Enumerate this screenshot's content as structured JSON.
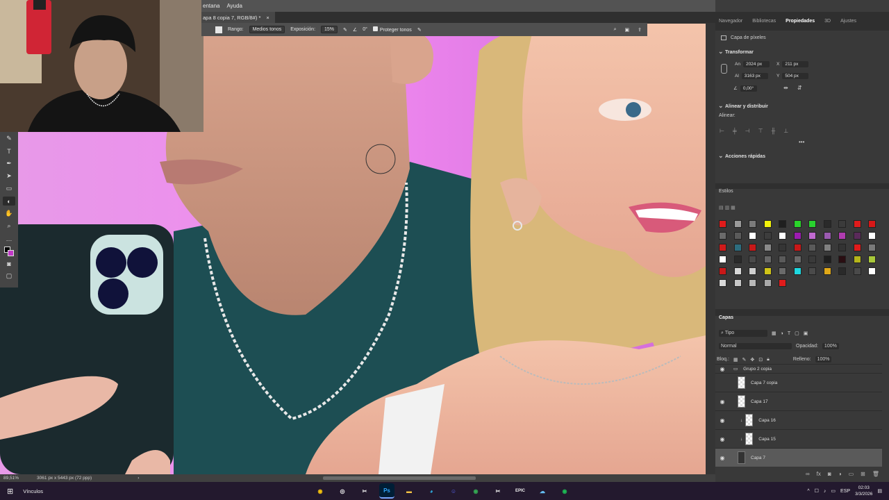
{
  "menubar": {
    "items": [
      "entana",
      "Ayuda"
    ]
  },
  "document_tab": {
    "title": "apa 8 copia 7, RGB/8#) *",
    "close": "×"
  },
  "options_bar": {
    "range_label": "Rango:",
    "range_value": "Medios tonos",
    "exposure_label": "Exposición:",
    "exposure_value": "15%",
    "angle_value": "0°",
    "protect_tones_label": "Proteger tonos"
  },
  "status_bar": {
    "zoom": "89,51%",
    "doc_info": "3061 px x 5443 px (72 ppp)"
  },
  "panel_tabs": [
    "Navegador",
    "Bibliotecas",
    "Propiedades",
    "3D",
    "Ajustes"
  ],
  "properties": {
    "layer_type": "Capa de píxeles",
    "transform_header": "Transformar",
    "width_label": "An",
    "width_value": "2024 px",
    "x_label": "X",
    "x_value": "211 px",
    "height_label": "Al",
    "height_value": "3163 px",
    "y_label": "Y",
    "y_value": "504 px",
    "angle_value": "0,00°",
    "align_header": "Alinear y distribuir",
    "align_label": "Alinear:",
    "quick_actions_header": "Acciones rápidas"
  },
  "styles_panel": {
    "title": "Estilos",
    "swatches": [
      "#e01b1b",
      "#9a9a9a",
      "#7b7b7b",
      "#f2f20b",
      "#1f1f1f",
      "#2ad42a",
      "#29d12f",
      "#2a2a2a",
      "#3b3b3b",
      "#e01b1b",
      "#d81818",
      "#6b6b6b",
      "#5a5a5a",
      "#ffffff",
      "#3d3d3d",
      "#ffffff",
      "#9b1bb0",
      "#c06ad0",
      "#9a5ab0",
      "#b03cb0",
      "#5a2a5a",
      "#ffffff",
      "#cf1a1a",
      "#2d6d7f",
      "#c81818",
      "#8a8a8a",
      "#353535",
      "#c81818",
      "#5a5a5a",
      "#808080",
      "#333333",
      "#e01b1b",
      "#7a7a7a",
      "#ffffff",
      "#2a2a2a",
      "#4a4a4a",
      "#686868",
      "#5a5a5a",
      "#6a6a6a",
      "#3a3a3a",
      "#1e1e1e",
      "#2a0e12",
      "#b5b51a",
      "#a8c83a",
      "#c81818",
      "#d8d8d8",
      "#cfcfcf",
      "#d0c418",
      "#6a6a6a",
      "#1ed8e0",
      "#4a4a4a",
      "#e0a818",
      "#2a2a2a",
      "#4a4a4a",
      "#ffffff",
      "#dadada",
      "#c8c8c8",
      "#b8b8b8",
      "#a8a8a8",
      "#e01b1b"
    ]
  },
  "layers_panel": {
    "title": "Capas",
    "filter_value": "Tipo",
    "blend_mode": "Normal",
    "opacity_label": "Opacidad:",
    "opacity_value": "100%",
    "lock_label": "Bloq.:",
    "fill_label": "Relleno:",
    "fill_value": "100%",
    "layers": [
      {
        "name": "Grupo 2 copia",
        "visible": true
      },
      {
        "name": "Capa 7 copia",
        "visible": false
      },
      {
        "name": "Capa 17",
        "visible": true
      },
      {
        "name": "Capa 16",
        "visible": true
      },
      {
        "name": "Capa 15",
        "visible": true
      },
      {
        "name": "Capa 7",
        "visible": true
      }
    ]
  },
  "taskbar": {
    "links_label": "Vínculos",
    "apps": [
      "Chrome",
      "OBS",
      "CapCut",
      "Ps",
      "Explorer",
      "Edge",
      "Discord",
      "Chrome",
      "CapCut",
      "Epic",
      "Steam",
      "Spotify"
    ],
    "language": "ESP",
    "time": "02:03",
    "date": "3/3/2026"
  }
}
